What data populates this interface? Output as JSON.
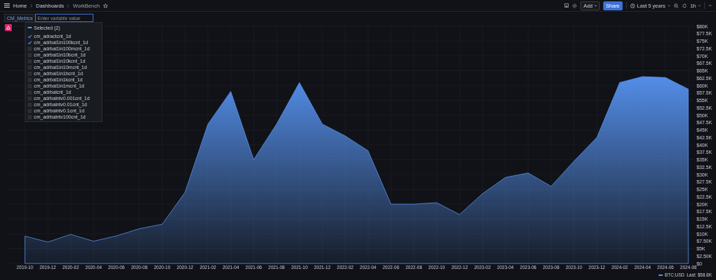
{
  "topbar": {
    "breadcrumbs": [
      "Home",
      "Dashboards",
      "WorkBench"
    ],
    "add_button": "Add",
    "share_button": "Share",
    "time_range": "Last 5 years",
    "refresh_interval": "1h"
  },
  "variable": {
    "label": "CM_Metrics",
    "placeholder": "Enter variable value"
  },
  "dropdown": {
    "header": "Selected (2)",
    "indeterminate": true,
    "options": [
      {
        "label": "cm_adractcnt_1d",
        "checked": true
      },
      {
        "label": "cm_adrbal1in100kcnt_1d",
        "checked": true
      },
      {
        "label": "cm_adrbal1in100mcnt_1d",
        "checked": false
      },
      {
        "label": "cm_adrbal1in10bcnt_1d",
        "checked": false
      },
      {
        "label": "cm_adrbal1in10kcnt_1d",
        "checked": false
      },
      {
        "label": "cm_adrbal1in10mcnt_1d",
        "checked": false
      },
      {
        "label": "cm_adrbal1in1bcnt_1d",
        "checked": false
      },
      {
        "label": "cm_adrbal1in1kcnt_1d",
        "checked": false
      },
      {
        "label": "cm_adrbal1in1mcnt_1d",
        "checked": false
      },
      {
        "label": "cm_adrbalcnt_1d",
        "checked": false
      },
      {
        "label": "cm_adrbalntv0.001cnt_1d",
        "checked": false
      },
      {
        "label": "cm_adrbalntv0.01cnt_1d",
        "checked": false
      },
      {
        "label": "cm_adrbalntv0.1cnt_1d",
        "checked": false
      },
      {
        "label": "cm_adrbalntv100cnt_1d",
        "checked": false
      }
    ]
  },
  "panel": {
    "legend_last": "Last: $58.8K",
    "chart_data": {
      "type": "area",
      "grid": true,
      "categories": [
        "2019-10",
        "2019-12",
        "2020-02",
        "2020-04",
        "2020-06",
        "2020-08",
        "2020-10",
        "2020-12",
        "2021-02",
        "2021-04",
        "2021-06",
        "2021-08",
        "2021-10",
        "2021-12",
        "2022-02",
        "2022-04",
        "2022-06",
        "2022-08",
        "2022-10",
        "2022-12",
        "2023-02",
        "2023-04",
        "2023-06",
        "2023-08",
        "2023-10",
        "2023-12",
        "2024-02",
        "2024-04",
        "2024-06",
        "2024-08"
      ],
      "series": [
        {
          "name": "BTC:USD",
          "color": "#5794f2",
          "values": [
            9.2,
            7.2,
            9.8,
            7.5,
            9.3,
            11.7,
            13.2,
            24,
            47,
            58,
            35,
            47,
            61,
            47,
            43,
            38,
            20,
            20,
            20.5,
            16.5,
            23.5,
            29,
            30.5,
            26,
            34.5,
            42.5,
            61,
            63,
            62.7,
            58.8
          ]
        }
      ],
      "ylim": [
        0,
        80
      ],
      "yticks": [
        {
          "value": 0,
          "label": "$0"
        },
        {
          "value": 2.5,
          "label": "$2.50K"
        },
        {
          "value": 5,
          "label": "$5K"
        },
        {
          "value": 7.5,
          "label": "$7.50K"
        },
        {
          "value": 10,
          "label": "$10K"
        },
        {
          "value": 12.5,
          "label": "$12.5K"
        },
        {
          "value": 15,
          "label": "$15K"
        },
        {
          "value": 17.5,
          "label": "$17.5K"
        },
        {
          "value": 20,
          "label": "$20K"
        },
        {
          "value": 22.5,
          "label": "$22.5K"
        },
        {
          "value": 25,
          "label": "$25K"
        },
        {
          "value": 27.5,
          "label": "$27.5K"
        },
        {
          "value": 30,
          "label": "$30K"
        },
        {
          "value": 32.5,
          "label": "$32.5K"
        },
        {
          "value": 35,
          "label": "$35K"
        },
        {
          "value": 37.5,
          "label": "$37.5K"
        },
        {
          "value": 40,
          "label": "$40K"
        },
        {
          "value": 42.5,
          "label": "$42.5K"
        },
        {
          "value": 45,
          "label": "$45K"
        },
        {
          "value": 47.5,
          "label": "$47.5K"
        },
        {
          "value": 50,
          "label": "$50K"
        },
        {
          "value": 52.5,
          "label": "$52.5K"
        },
        {
          "value": 55,
          "label": "$55K"
        },
        {
          "value": 57.5,
          "label": "$57.5K"
        },
        {
          "value": 60,
          "label": "$60K"
        },
        {
          "value": 62.5,
          "label": "$62.5K"
        },
        {
          "value": 65,
          "label": "$65K"
        },
        {
          "value": 67.5,
          "label": "$67.5K"
        },
        {
          "value": 70,
          "label": "$70K"
        },
        {
          "value": 72.5,
          "label": "$72.5K"
        },
        {
          "value": 75,
          "label": "$75K"
        },
        {
          "value": 77.5,
          "label": "$77.5K"
        },
        {
          "value": 80,
          "label": "$80K"
        }
      ]
    }
  }
}
